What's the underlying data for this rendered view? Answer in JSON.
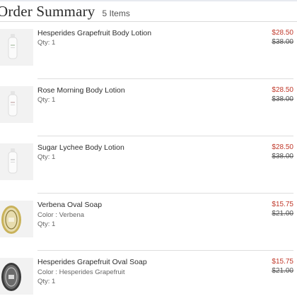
{
  "order_summary": {
    "title": "Order Summary",
    "item_count": "5 Items"
  },
  "items": [
    {
      "name": "Hesperides Grapefruit Body Lotion",
      "color": "",
      "qty": "Qty: 1",
      "sale_price": "$28.50",
      "original_price": "$38.00",
      "thumb_icon": "lotion-bottle-icon"
    },
    {
      "name": "Rose Morning Body Lotion",
      "color": "",
      "qty": "Qty: 1",
      "sale_price": "$28.50",
      "original_price": "$38.00",
      "thumb_icon": "lotion-bottle-icon"
    },
    {
      "name": "Sugar Lychee Body Lotion",
      "color": "",
      "qty": "Qty: 1",
      "sale_price": "$28.50",
      "original_price": "$38.00",
      "thumb_icon": "lotion-bottle-icon"
    },
    {
      "name": "Verbena Oval Soap",
      "color": "Color : Verbena",
      "qty": "Qty: 1",
      "sale_price": "$15.75",
      "original_price": "$21.00",
      "thumb_icon": "oval-soap-icon"
    },
    {
      "name": "Hesperides Grapefruit Oval Soap",
      "color": "Color : Hesperides Grapefruit",
      "qty": "Qty: 1",
      "sale_price": "$15.75",
      "original_price": "$21.00",
      "thumb_icon": "oval-soap-icon"
    }
  ],
  "colors": {
    "sale_price": "#c0392b",
    "divider": "#dedede",
    "soap_verbena": "#c9b25a",
    "soap_grapefruit": "#3b3b3b"
  }
}
